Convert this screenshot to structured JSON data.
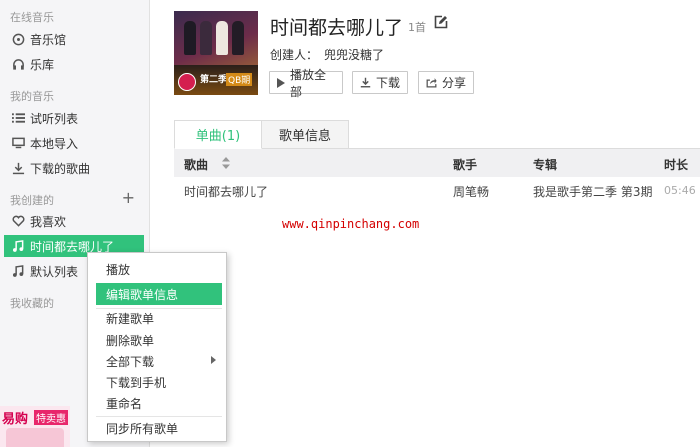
{
  "sidebar": {
    "online_section": "在线音乐",
    "music_hall": "音乐馆",
    "library": "乐库",
    "my_music_section": "我的音乐",
    "trial_list": "试听列表",
    "local_import": "本地导入",
    "downloaded": "下载的歌曲",
    "created_section": "我创建的",
    "favorites": "我喜欢",
    "playlist_active": "时间都去哪儿了",
    "default_list": "默认列表",
    "collected_section": "我收藏的",
    "ad_text": "易购",
    "ad_badge": "特卖惠"
  },
  "playlist": {
    "title": "时间都去哪儿了",
    "count": "1首",
    "creator_label": "创建人：",
    "creator_name": "兜兜没糖了",
    "cover_text": "第二季",
    "cover_badge": "QB期"
  },
  "actions": {
    "play_all": "播放全部",
    "download": "下载",
    "share": "分享"
  },
  "tabs": [
    {
      "label": "单曲(1)",
      "active": true
    },
    {
      "label": "歌单信息",
      "active": false
    }
  ],
  "table": {
    "headers": {
      "song": "歌曲",
      "artist": "歌手",
      "album": "专辑",
      "duration": "时长"
    },
    "rows": [
      {
        "song": "时间都去哪儿了",
        "artist": "周笔畅",
        "album": "我是歌手第二季 第3期",
        "duration": "05:46"
      }
    ]
  },
  "watermark": "www.qinpinchang.com",
  "context_menu": {
    "items": [
      "播放",
      "编辑歌单信息",
      "新建歌单",
      "删除歌单",
      "全部下载",
      "下载到手机",
      "重命名",
      "同步所有歌单"
    ]
  },
  "colors": {
    "accent": "#31c27c"
  }
}
